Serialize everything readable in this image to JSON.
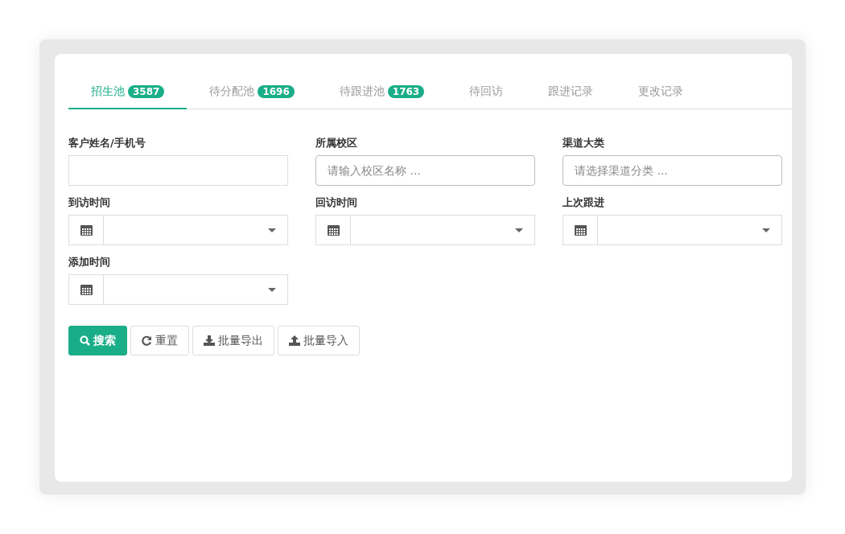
{
  "tabs": [
    {
      "label": "招生池",
      "count": "3587",
      "selected": true
    },
    {
      "label": "待分配池",
      "count": "1696",
      "selected": false
    },
    {
      "label": "待跟进池",
      "count": "1763",
      "selected": false
    },
    {
      "label": "待回访",
      "selected": false
    },
    {
      "label": "跟进记录",
      "selected": false
    },
    {
      "label": "更改记录",
      "selected": false
    }
  ],
  "filters": [
    {
      "label": "客户姓名/手机号",
      "kind": "text"
    },
    {
      "label": "所属校区",
      "kind": "select",
      "placeholder": "请输入校区名称 ..."
    },
    {
      "label": "渠道大类",
      "kind": "select",
      "placeholder": "请选择渠道分类 ..."
    },
    {
      "label": "到访时间",
      "kind": "date"
    },
    {
      "label": "回访时间",
      "kind": "date"
    },
    {
      "label": "上次跟进",
      "kind": "date"
    },
    {
      "label": "添加时间",
      "kind": "date"
    }
  ],
  "buttons": [
    {
      "label": "搜索",
      "kind": "search"
    },
    {
      "label": "重置",
      "kind": "reset"
    },
    {
      "label": "批量导出",
      "kind": "export"
    },
    {
      "label": "批量导入",
      "kind": "import"
    }
  ]
}
